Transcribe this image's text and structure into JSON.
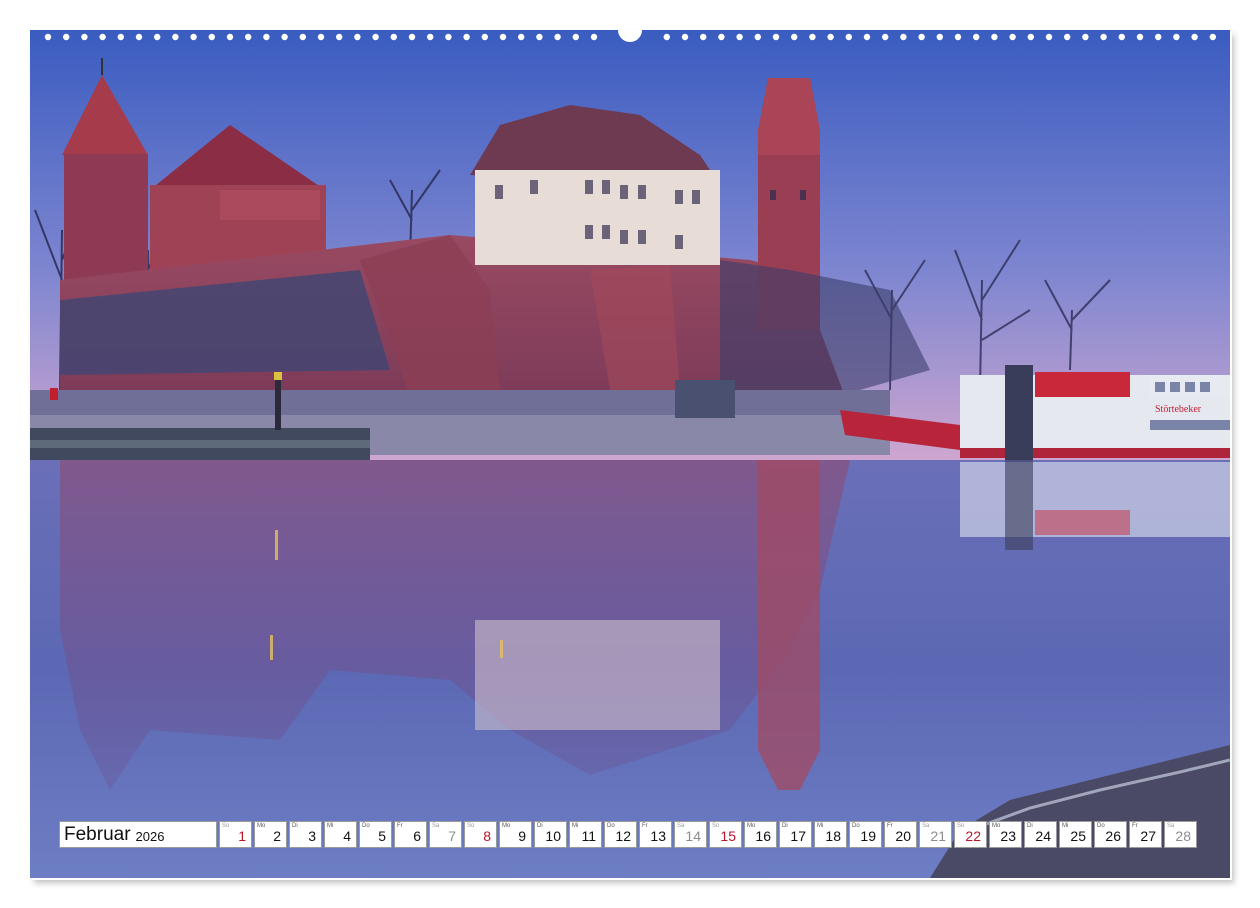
{
  "calendar": {
    "month": "Februar",
    "year": "2026",
    "days": [
      {
        "wd": "So",
        "num": "1",
        "type": "sunday"
      },
      {
        "wd": "Mo",
        "num": "2",
        "type": "weekday"
      },
      {
        "wd": "Di",
        "num": "3",
        "type": "weekday"
      },
      {
        "wd": "Mi",
        "num": "4",
        "type": "weekday"
      },
      {
        "wd": "Do",
        "num": "5",
        "type": "weekday"
      },
      {
        "wd": "Fr",
        "num": "6",
        "type": "weekday"
      },
      {
        "wd": "Sa",
        "num": "7",
        "type": "weekend"
      },
      {
        "wd": "So",
        "num": "8",
        "type": "sunday"
      },
      {
        "wd": "Mo",
        "num": "9",
        "type": "weekday"
      },
      {
        "wd": "Di",
        "num": "10",
        "type": "weekday"
      },
      {
        "wd": "Mi",
        "num": "11",
        "type": "weekday"
      },
      {
        "wd": "Do",
        "num": "12",
        "type": "weekday"
      },
      {
        "wd": "Fr",
        "num": "13",
        "type": "weekday"
      },
      {
        "wd": "Sa",
        "num": "14",
        "type": "weekend"
      },
      {
        "wd": "So",
        "num": "15",
        "type": "sunday"
      },
      {
        "wd": "Mo",
        "num": "16",
        "type": "weekday"
      },
      {
        "wd": "Di",
        "num": "17",
        "type": "weekday"
      },
      {
        "wd": "Mi",
        "num": "18",
        "type": "weekday"
      },
      {
        "wd": "Do",
        "num": "19",
        "type": "weekday"
      },
      {
        "wd": "Fr",
        "num": "20",
        "type": "weekday"
      },
      {
        "wd": "Sa",
        "num": "21",
        "type": "weekend"
      },
      {
        "wd": "So",
        "num": "22",
        "type": "sunday"
      },
      {
        "wd": "Mo",
        "num": "23",
        "type": "weekday"
      },
      {
        "wd": "Di",
        "num": "24",
        "type": "weekday"
      },
      {
        "wd": "Mi",
        "num": "25",
        "type": "weekday"
      },
      {
        "wd": "Do",
        "num": "26",
        "type": "weekday"
      },
      {
        "wd": "Fr",
        "num": "27",
        "type": "weekday"
      },
      {
        "wd": "Sa",
        "num": "28",
        "type": "weekend"
      }
    ]
  },
  "photo": {
    "ship_name": "Störtebeker",
    "colors": {
      "sky_top": "#3f5fbf",
      "sky_bottom": "#c9a3cf",
      "brick": "#b8505a",
      "water": "#5c6bb5",
      "sunday_red": "#b8142a"
    }
  }
}
